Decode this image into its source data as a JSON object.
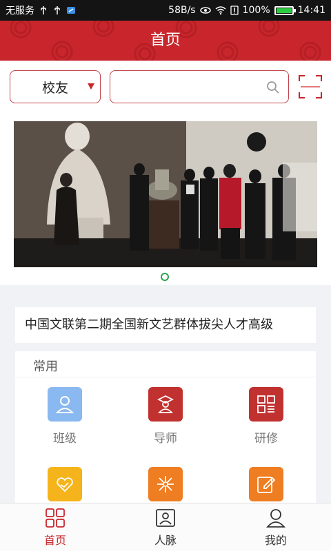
{
  "status_bar": {
    "carrier": "无服务",
    "net_speed": "58B/s",
    "battery_text": "100%",
    "battery_level": 1.0,
    "time": "14:41"
  },
  "header": {
    "title": "首页",
    "bg_color": "#c8262c"
  },
  "search": {
    "category_selected": "校友",
    "input_value": "",
    "placeholder": ""
  },
  "carousel": {
    "slide_count": 1,
    "active_index": 0,
    "indicator_color": "#2ea44f"
  },
  "notice": {
    "text": "中国文联第二期全国新文艺群体拔尖人才高级"
  },
  "common": {
    "title": "常用",
    "items": [
      {
        "label": "班级",
        "icon": "user-icon",
        "color": "#8ab8f0"
      },
      {
        "label": "导师",
        "icon": "teacher-icon",
        "color": "#c0312f"
      },
      {
        "label": "研修",
        "icon": "grid-list-icon",
        "color": "#c0312f"
      },
      {
        "label": "",
        "icon": "heart-hand-icon",
        "color": "#f5b41b"
      },
      {
        "label": "",
        "icon": "sparkle-icon",
        "color": "#ef7d22"
      },
      {
        "label": "",
        "icon": "edit-icon",
        "color": "#ef7d22"
      }
    ]
  },
  "tabbar": {
    "tabs": [
      {
        "label": "首页",
        "icon": "home-grid-icon",
        "active": true
      },
      {
        "label": "人脉",
        "icon": "contacts-icon",
        "active": false
      },
      {
        "label": "我的",
        "icon": "profile-icon",
        "active": false
      }
    ],
    "active_color": "#c8262c",
    "inactive_color": "#333333"
  }
}
